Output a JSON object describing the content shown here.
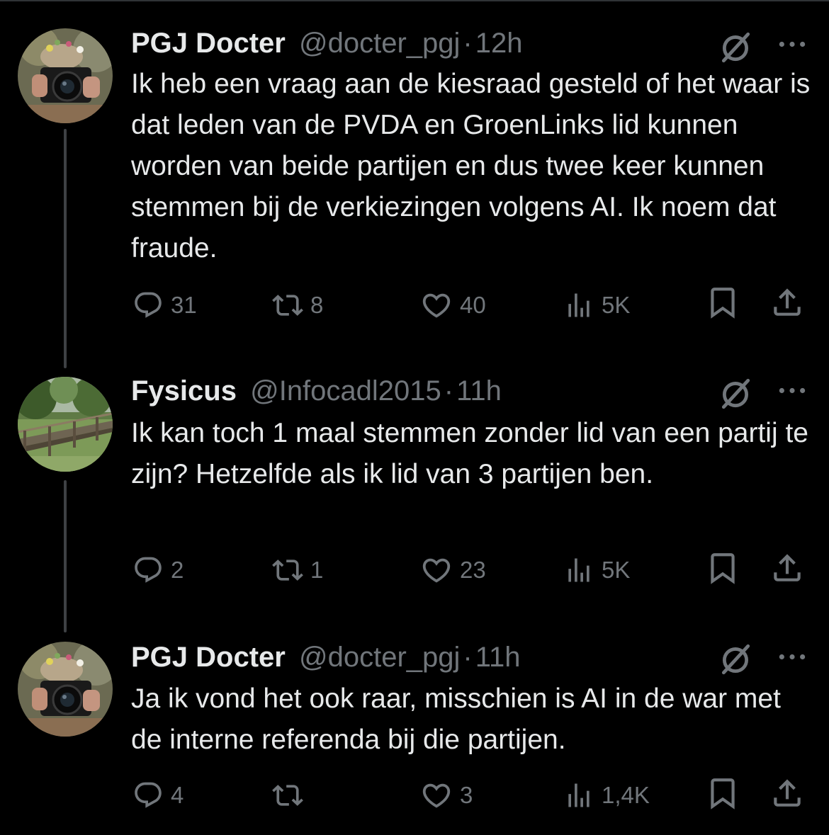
{
  "colors": {
    "background": "#000000",
    "text_primary": "#e7e9ea",
    "text_secondary": "#71767b",
    "thread_line": "#3e4144"
  },
  "icons": {
    "no_reply": "slashed-circle-icon",
    "more": "more-dots-icon",
    "reply": "reply-icon",
    "repost": "repost-icon",
    "like": "like-icon",
    "views": "views-icon",
    "bookmark": "bookmark-icon",
    "share": "share-icon"
  },
  "tweets": [
    {
      "name": "PGJ Docter",
      "handle": "@docter_pgj",
      "dot": "·",
      "time": "12h",
      "text": "Ik heb een vraag aan de kiesraad gesteld of het waar is dat leden van de PVDA en GroenLinks lid kunnen worden van beide partijen en dus twee keer kunnen stemmen bij de verkiezingen volgens AI. Ik noem dat fraude.",
      "replies": "31",
      "reposts": "8",
      "likes": "40",
      "views": "5K"
    },
    {
      "name": "Fysicus",
      "handle": "@Infocadl2015",
      "dot": "·",
      "time": "11h",
      "text": "Ik kan toch 1 maal stemmen zonder lid van een partij te zijn? Hetzelfde als ik lid van 3 partijen ben.",
      "replies": "2",
      "reposts": "1",
      "likes": "23",
      "views": "5K"
    },
    {
      "name": "PGJ Docter",
      "handle": "@docter_pgj",
      "dot": "·",
      "time": "11h",
      "text": "Ja ik vond het ook raar, misschien is AI in de war met de interne referenda bij die partijen.",
      "replies": "4",
      "reposts": "",
      "likes": "3",
      "views": "1,4K"
    }
  ]
}
